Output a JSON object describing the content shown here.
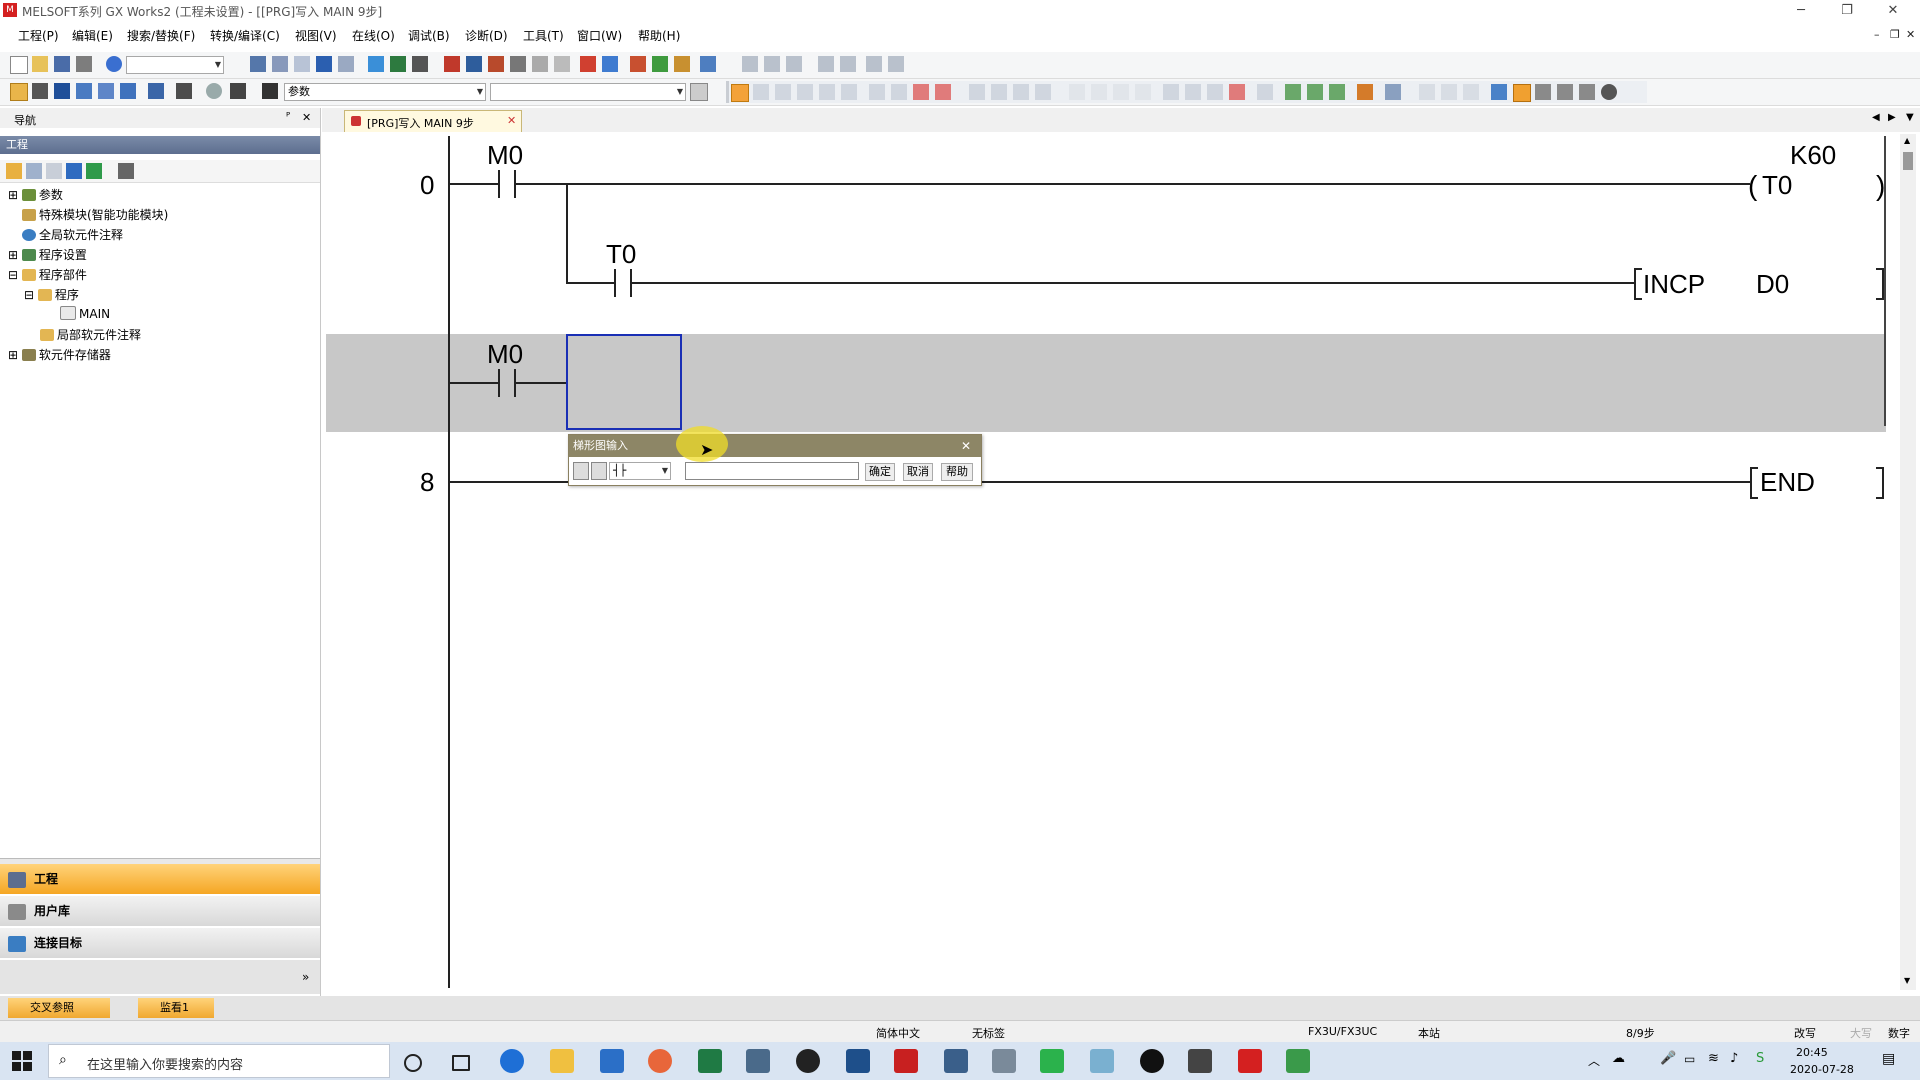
{
  "window": {
    "title": "MELSOFT系列 GX Works2 (工程未设置) - [[PRG]写入 MAIN 9步]",
    "app_icon_label": "M",
    "minimize": "─",
    "restore": "❐",
    "close": "✕"
  },
  "menu": [
    "工程(P)",
    "编辑(E)",
    "搜索/替换(F)",
    "转换/编译(C)",
    "视图(V)",
    "在线(O)",
    "调试(B)",
    "诊断(D)",
    "工具(T)",
    "窗口(W)",
    "帮助(H)"
  ],
  "toolbar": {
    "combo_value": "参数"
  },
  "navigation": {
    "title": "导航",
    "pin": "ᴾ",
    "close": "✕",
    "section": "工程",
    "tree": [
      {
        "label": "参数"
      },
      {
        "label": "特殊模块(智能功能模块)"
      },
      {
        "label": "全局软元件注释"
      },
      {
        "label": "程序设置"
      },
      {
        "label": "程序部件"
      },
      {
        "label": "程序"
      },
      {
        "label": "MAIN"
      },
      {
        "label": "局部软元件注释"
      },
      {
        "label": "软元件存储器"
      }
    ],
    "categories": [
      "工程",
      "用户库",
      "连接目标"
    ],
    "more": "»"
  },
  "editor": {
    "tab_label": "[PRG]写入 MAIN 9步",
    "tab_close": "✕",
    "ladder": {
      "rung0_step": "0",
      "rung0_contact": "M0",
      "rung0_coil_const": "K60",
      "rung0_coil": "T0",
      "rung0_branch_contact": "T0",
      "rung0_instruction": "INCP",
      "rung0_operand": "D0",
      "rung_edit_contact": "M0",
      "rung8_step": "8",
      "rung8_end": "END"
    }
  },
  "dialog": {
    "title": "梯形图输入",
    "close": "✕",
    "symbol_value": "┤├",
    "input_value": "",
    "ok": "确定",
    "cancel": "取消",
    "help": "帮助"
  },
  "bottom_tabs": [
    "交叉参照",
    "监看1"
  ],
  "statusbar": {
    "language": "简体中文",
    "label": "无标签",
    "plc": "FX3U/FX3UC",
    "station": "本站",
    "steps": "8/9步",
    "mode": "改写",
    "caps": "大写",
    "num": "数字"
  },
  "taskbar": {
    "search_placeholder": "在这里输入你要搜索的内容",
    "time": "20:45",
    "date": "2020-07-28"
  },
  "colors": {
    "dialog_title": "#8d8666",
    "active_category": "#f5b642",
    "edit_rung_bg": "#c8c8c8",
    "cursor_border": "#1a2fb5",
    "taskbar": "#d9e4f2"
  }
}
